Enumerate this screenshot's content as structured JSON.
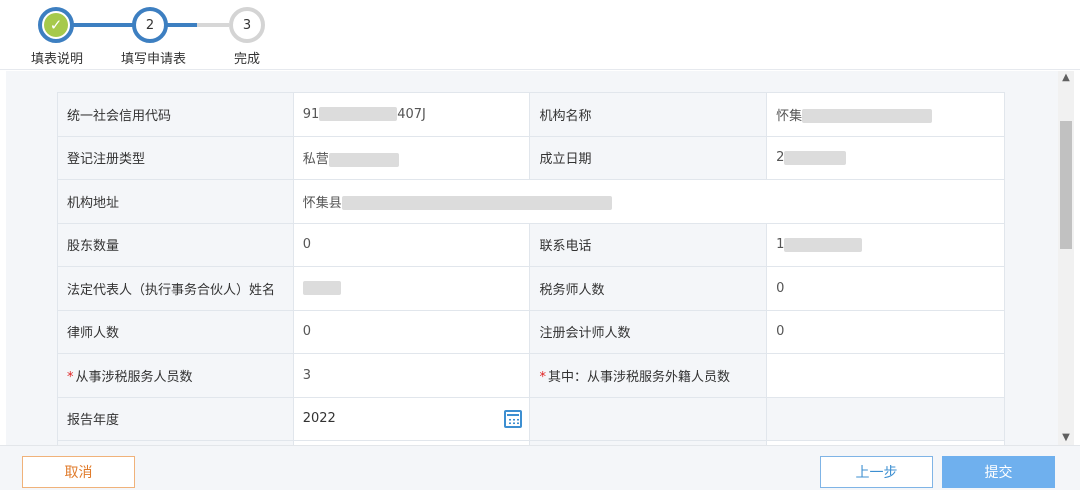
{
  "steps": [
    {
      "number": "",
      "label": "填表说明",
      "state": "done"
    },
    {
      "number": "2",
      "label": "填写申请表",
      "state": "active"
    },
    {
      "number": "3",
      "label": "完成",
      "state": "todo"
    }
  ],
  "form": {
    "unified_code_label": "统一社会信用代码",
    "unified_code_value_start": "91",
    "unified_code_value_end": "407J",
    "org_name_label": "机构名称",
    "org_name_value": "怀集",
    "reg_type_label": "登记注册类型",
    "reg_type_value": "私营",
    "est_date_label": "成立日期",
    "est_date_value": "2",
    "address_label": "机构地址",
    "address_value": "怀集县",
    "shareholders_label": "股东数量",
    "shareholders_value": "0",
    "phone_label": "联系电话",
    "phone_value": "1",
    "legal_rep_label": "法定代表人（执行事务合伙人）姓名",
    "tax_agents_label": "税务师人数",
    "tax_agents_value": "0",
    "lawyers_label": "律师人数",
    "lawyers_value": "0",
    "cpa_label": "注册会计师人数",
    "cpa_value": "0",
    "tax_staff_label": "从事涉税服务人员数",
    "tax_staff_value": "3",
    "foreign_staff_label": "其中：从事涉税服务外籍人员数",
    "foreign_staff_value": "",
    "report_year_label": "报告年度",
    "report_year_value": "2022"
  },
  "footer": {
    "cancel_label": "取消",
    "prev_label": "上一步",
    "submit_label": "提交"
  },
  "colors": {
    "accent": "#3d7fc1",
    "done_check": "#a6c94b",
    "cancel": "#e07b2b",
    "submit_bg": "#6fb0ee"
  }
}
